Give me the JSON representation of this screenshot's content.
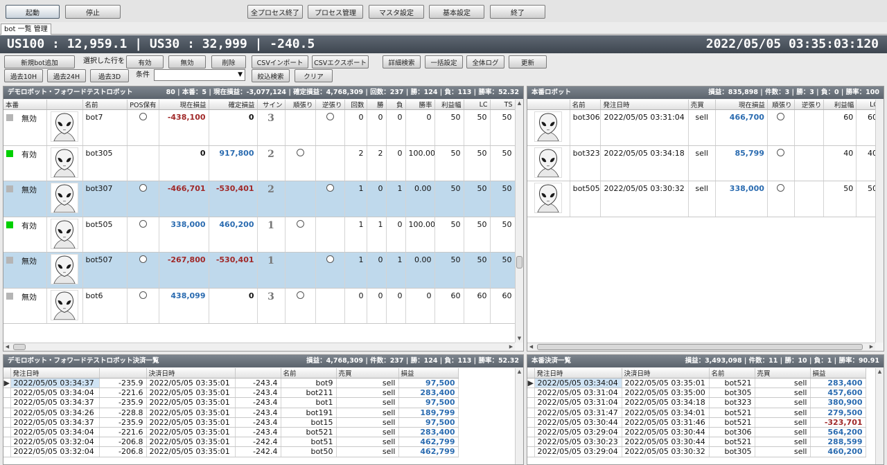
{
  "topbar": {
    "start": "起動",
    "stop": "停止",
    "stop_all": "全プロセス終了",
    "process_mgmt": "プロセス管理",
    "master": "マスタ設定",
    "basic": "基本設定",
    "exit": "終了"
  },
  "tab": "bot 一覧 管理",
  "ticker": {
    "left": "US100 : 12,959.1 | US30 : 32,999 | -240.5",
    "datetime": "2022/05/05 03:35:03:120"
  },
  "toolbar": {
    "new_bot": "新規bot追加",
    "selected_rows": "選択した行を",
    "enable": "有効",
    "disable": "無効",
    "delete": "削除",
    "csv_import": "CSVインポート",
    "csv_export": "CSVエクスポート",
    "detail_search": "詳細検索",
    "bulk_settings": "一括設定",
    "all_logs": "全体ログ",
    "refresh": "更新",
    "past10h": "過去10H",
    "past24h": "過去24H",
    "past3d": "過去3D",
    "condition": "条件",
    "filter": "絞込検索",
    "clear": "クリア"
  },
  "demo": {
    "title": "デモロボット・フォワードテストロボット",
    "stats": "80 | 本番：5 | 現在損益：-3,077,124 | 確定損益：4,768,309 | 回数：237 | 勝：124 | 負：113 | 勝率：52.32",
    "headers": [
      "本番",
      "",
      "名前",
      "POS保有",
      "現在損益",
      "確定損益",
      "サイン",
      "順張り",
      "逆張り",
      "回数",
      "勝",
      "負",
      "勝率",
      "利益幅",
      "LC",
      "TS"
    ],
    "rows": [
      {
        "status": "無効",
        "on": false,
        "name": "bot7",
        "pos": true,
        "cur": "-438,100",
        "cur_c": "red",
        "fix": "0",
        "fix_c": "bold",
        "sign": "3",
        "jun": false,
        "gyaku": true,
        "n": "0",
        "w": "0",
        "l": "0",
        "rate": "0",
        "profit": "50",
        "lc": "50",
        "ts": "50",
        "sel": false,
        "mark": false
      },
      {
        "status": "有効",
        "on": true,
        "name": "bot305",
        "pos": false,
        "cur": "0",
        "cur_c": "bold",
        "fix": "917,800",
        "fix_c": "blue",
        "sign": "2",
        "jun": true,
        "gyaku": false,
        "n": "2",
        "w": "2",
        "l": "0",
        "rate": "100.00",
        "profit": "50",
        "lc": "50",
        "ts": "50",
        "sel": false,
        "mark": false
      },
      {
        "status": "無効",
        "on": false,
        "name": "bot307",
        "pos": true,
        "cur": "-466,701",
        "cur_c": "red",
        "fix": "-530,401",
        "fix_c": "red",
        "sign": "2",
        "jun": false,
        "gyaku": true,
        "n": "1",
        "w": "0",
        "l": "1",
        "rate": "0.00",
        "profit": "50",
        "lc": "50",
        "ts": "50",
        "sel": true,
        "mark": false
      },
      {
        "status": "有効",
        "on": true,
        "name": "bot505",
        "pos": true,
        "cur": "338,000",
        "cur_c": "blue",
        "fix": "460,200",
        "fix_c": "blue",
        "sign": "1",
        "jun": true,
        "gyaku": false,
        "n": "1",
        "w": "1",
        "l": "0",
        "rate": "100.00",
        "profit": "50",
        "lc": "50",
        "ts": "50",
        "sel": false,
        "mark": false
      },
      {
        "status": "無効",
        "on": false,
        "name": "bot507",
        "pos": true,
        "cur": "-267,800",
        "cur_c": "red",
        "fix": "-530,401",
        "fix_c": "red",
        "sign": "1",
        "jun": false,
        "gyaku": true,
        "n": "1",
        "w": "0",
        "l": "1",
        "rate": "0.00",
        "profit": "50",
        "lc": "50",
        "ts": "50",
        "sel": true,
        "mark": true
      },
      {
        "status": "無効",
        "on": false,
        "name": "bot6",
        "pos": true,
        "cur": "438,099",
        "cur_c": "blue",
        "fix": "0",
        "fix_c": "bold",
        "sign": "3",
        "jun": true,
        "gyaku": false,
        "n": "0",
        "w": "0",
        "l": "0",
        "rate": "0",
        "profit": "60",
        "lc": "60",
        "ts": "60",
        "sel": false,
        "mark": false
      }
    ]
  },
  "live": {
    "title": "本番ロボット",
    "stats": "損益：835,898 | 件数：3 | 勝：3 | 負：0 | 勝率：100",
    "headers": [
      "",
      "名前",
      "発注日時",
      "売買",
      "現在損益",
      "順張り",
      "逆張り",
      "利益幅",
      "LC"
    ],
    "rows": [
      {
        "name": "bot306",
        "date": "2022/05/05 03:31:04",
        "side": "sell",
        "cur": "466,700",
        "jun": true,
        "profit": "60",
        "lc": "60",
        "mark": true
      },
      {
        "name": "bot323",
        "date": "2022/05/05 03:34:18",
        "side": "sell",
        "cur": "85,799",
        "jun": true,
        "profit": "40",
        "lc": "40",
        "mark": false
      },
      {
        "name": "bot505",
        "date": "2022/05/05 03:30:32",
        "side": "sell",
        "cur": "338,000",
        "jun": true,
        "profit": "50",
        "lc": "50",
        "mark": false
      }
    ]
  },
  "demo_settle": {
    "title": "デモロボット・フォワードテストロボット決済一覧",
    "stats": "損益：4,768,309 | 件数：237 | 勝：124 | 負：113 | 勝率：52.32",
    "headers": [
      "発注日時",
      "",
      "決済日時",
      "",
      "名前",
      "売買",
      "損益"
    ],
    "rows": [
      [
        "2022/05/05 03:34:37",
        "-235.9",
        "2022/05/05 03:35:01",
        "-243.4",
        "bot9",
        "sell",
        "97,500"
      ],
      [
        "2022/05/05 03:34:04",
        "-221.6",
        "2022/05/05 03:35:01",
        "-243.4",
        "bot211",
        "sell",
        "283,400"
      ],
      [
        "2022/05/05 03:34:37",
        "-235.9",
        "2022/05/05 03:35:01",
        "-243.4",
        "bot1",
        "sell",
        "97,500"
      ],
      [
        "2022/05/05 03:34:26",
        "-228.8",
        "2022/05/05 03:35:01",
        "-243.4",
        "bot191",
        "sell",
        "189,799"
      ],
      [
        "2022/05/05 03:34:37",
        "-235.9",
        "2022/05/05 03:35:01",
        "-243.4",
        "bot15",
        "sell",
        "97,500"
      ],
      [
        "2022/05/05 03:34:04",
        "-221.6",
        "2022/05/05 03:35:01",
        "-243.4",
        "bot521",
        "sell",
        "283,400"
      ],
      [
        "2022/05/05 03:32:04",
        "-206.8",
        "2022/05/05 03:35:01",
        "-242.4",
        "bot51",
        "sell",
        "462,799"
      ],
      [
        "2022/05/05 03:32:04",
        "-206.8",
        "2022/05/05 03:35:01",
        "-242.4",
        "bot50",
        "sell",
        "462,799"
      ]
    ]
  },
  "live_settle": {
    "title": "本番決済一覧",
    "stats": "損益：3,493,098 | 件数：11 | 勝：10 | 負：1 | 勝率：90.91",
    "headers": [
      "発注日時",
      "決済日時",
      "名前",
      "売買",
      "損益"
    ],
    "rows": [
      [
        "2022/05/05 03:34:04",
        "2022/05/05 03:35:01",
        "bot521",
        "sell",
        "283,400"
      ],
      [
        "2022/05/05 03:31:04",
        "2022/05/05 03:35:00",
        "bot305",
        "sell",
        "457,600"
      ],
      [
        "2022/05/05 03:31:04",
        "2022/05/05 03:34:18",
        "bot323",
        "sell",
        "380,900"
      ],
      [
        "2022/05/05 03:31:47",
        "2022/05/05 03:34:01",
        "bot521",
        "sell",
        "279,500"
      ],
      [
        "2022/05/05 03:30:44",
        "2022/05/05 03:31:46",
        "bot521",
        "sell",
        "-323,701"
      ],
      [
        "2022/05/05 03:29:04",
        "2022/05/05 03:30:44",
        "bot306",
        "sell",
        "564,200"
      ],
      [
        "2022/05/05 03:30:23",
        "2022/05/05 03:30:44",
        "bot521",
        "sell",
        "288,599"
      ],
      [
        "2022/05/05 03:29:04",
        "2022/05/05 03:30:32",
        "bot305",
        "sell",
        "460,200"
      ]
    ]
  },
  "colors": {
    "header_bg": "#5c646d",
    "selected_row": "#bfd9ec",
    "positive": "#2a6bb0",
    "negative": "#a02828",
    "enabled": "#00d000"
  },
  "icons": {
    "avatar": "alien-avatar-icon",
    "radio": "circle-indicator-icon"
  }
}
